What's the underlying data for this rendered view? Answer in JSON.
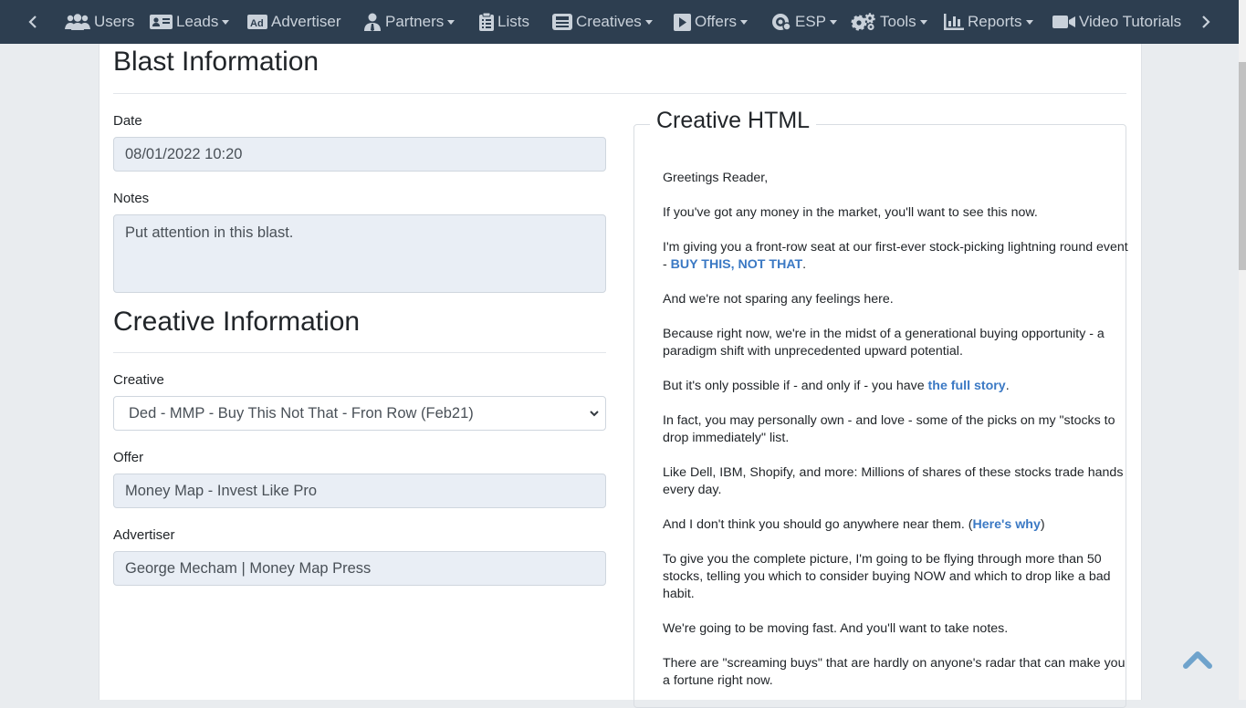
{
  "nav": {
    "items": [
      {
        "label": "Users",
        "icon": "users-icon"
      },
      {
        "label": "Leads",
        "icon": "id-card-icon",
        "dropdown": true
      },
      {
        "label": "Advertiser",
        "icon": "ad-icon"
      },
      {
        "label": "Partners",
        "icon": "user-tie-icon",
        "dropdown": true
      },
      {
        "label": "Lists",
        "icon": "clipboard-list-icon"
      },
      {
        "label": "Creatives",
        "icon": "newspaper-icon",
        "dropdown": true
      },
      {
        "label": "Offers",
        "icon": "play-square-icon",
        "dropdown": true
      },
      {
        "label": "ESP",
        "icon": "email-gear-icon",
        "dropdown": true
      },
      {
        "label": "Tools",
        "icon": "cogs-icon",
        "dropdown": true
      },
      {
        "label": "Reports",
        "icon": "bar-chart-icon",
        "dropdown": true
      },
      {
        "label": "Video Tutorials",
        "icon": "video-camera-icon"
      }
    ],
    "text_color": "#c9d1da",
    "background": "#2d3e50"
  },
  "blast": {
    "heading": "Blast Information",
    "date_label": "Date",
    "date_value": "08/01/2022 10:20",
    "notes_label": "Notes",
    "notes_value": "Put attention in this blast."
  },
  "creative_info": {
    "heading": "Creative Information",
    "creative_label": "Creative",
    "creative_selected": "Ded - MMP - Buy This Not That - Fron Row (Feb21)",
    "offer_label": "Offer",
    "offer_value": "Money Map - Invest Like Pro",
    "advertiser_label": "Advertiser",
    "advertiser_value": "George Mecham | Money Map Press"
  },
  "creative_html": {
    "legend": "Creative HTML",
    "p1": "Greetings Reader,",
    "p2": "If you've got any money in the market, you'll want to see this now.",
    "p3_text": "I'm giving you a front-row seat at our first-ever stock-picking lightning round event - ",
    "p3_link": "BUY THIS, NOT THAT",
    "p3_end": ".",
    "p4": "And we're not sparing any feelings here.",
    "p5": "Because right now, we're in the midst of a generational buying opportunity - a paradigm shift with unprecedented upward potential.",
    "p6_text": "But it's only possible if - and only if - you have ",
    "p6_link": "the full story",
    "p6_end": ".",
    "p7": "In fact, you may personally own - and love - some of the picks on my \"stocks to drop immediately\" list.",
    "p8": "Like Dell, IBM, Shopify, and more: Millions of shares of these stocks trade hands every day.",
    "p9_text": "And I don't think you should go anywhere near them. (",
    "p9_link": "Here's why",
    "p9_end": ")",
    "p10": "To give you the complete picture, I'm going to be flying through more than 50 stocks, telling you which to consider buying NOW and which to drop like a bad habit.",
    "p11": "We're going to be moving fast. And you'll want to take notes.",
    "p12": "There are \"screaming buys\" that are hardly on anyone's radar that can make you a fortune right now.",
    "link_color": "#3b79c4"
  },
  "scroll_top": {
    "icon": "chevron-up-icon",
    "color": "#6fa3cc"
  }
}
